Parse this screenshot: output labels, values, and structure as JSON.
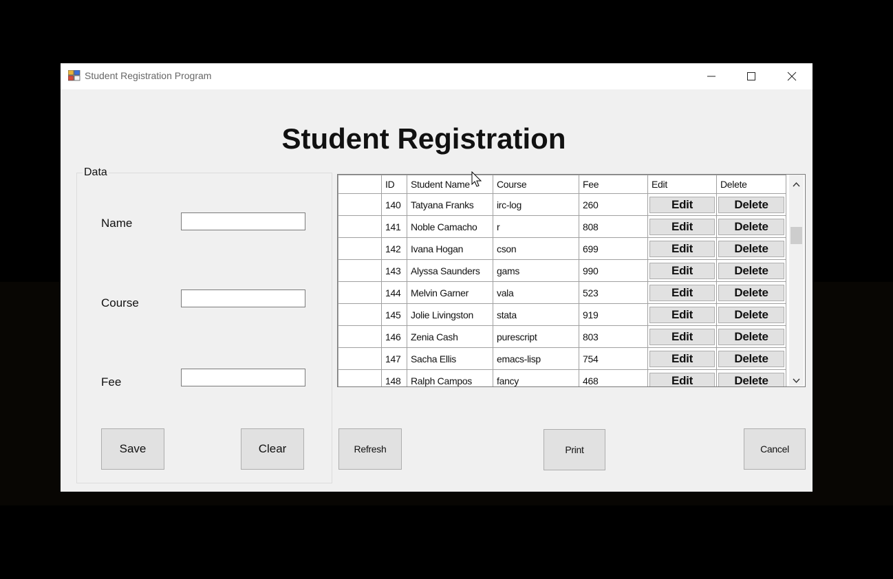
{
  "window": {
    "title": "Student Registration Program",
    "controls": [
      "minimize-icon",
      "maximize-icon",
      "close-icon"
    ]
  },
  "form": {
    "heading": "Student Registration",
    "group_label": "Data",
    "name_label": "Name",
    "name_value": "",
    "course_label": "Course",
    "course_value": "",
    "fee_label": "Fee",
    "fee_value": "",
    "save_label": "Save",
    "clear_label": "Clear"
  },
  "grid": {
    "columns": [
      "",
      "ID",
      "Student Name",
      "Course",
      "Fee",
      "Edit",
      "Delete"
    ],
    "rows": [
      {
        "id": "140",
        "name": "Tatyana Franks",
        "course": "irc-log",
        "fee": "260",
        "edit": "Edit",
        "delete": "Delete"
      },
      {
        "id": "141",
        "name": "Noble Camacho",
        "course": "r",
        "fee": "808",
        "edit": "Edit",
        "delete": "Delete"
      },
      {
        "id": "142",
        "name": "Ivana Hogan",
        "course": "cson",
        "fee": "699",
        "edit": "Edit",
        "delete": "Delete"
      },
      {
        "id": "143",
        "name": "Alyssa Saunders",
        "course": "gams",
        "fee": "990",
        "edit": "Edit",
        "delete": "Delete"
      },
      {
        "id": "144",
        "name": "Melvin Garner",
        "course": "vala",
        "fee": "523",
        "edit": "Edit",
        "delete": "Delete"
      },
      {
        "id": "145",
        "name": "Jolie Livingston",
        "course": "stata",
        "fee": "919",
        "edit": "Edit",
        "delete": "Delete"
      },
      {
        "id": "146",
        "name": "Zenia Cash",
        "course": "purescript",
        "fee": "803",
        "edit": "Edit",
        "delete": "Delete"
      },
      {
        "id": "147",
        "name": "Sacha Ellis",
        "course": "emacs-lisp",
        "fee": "754",
        "edit": "Edit",
        "delete": "Delete"
      },
      {
        "id": "148",
        "name": "Ralph Campos",
        "course": "fancy",
        "fee": "468",
        "edit": "Edit",
        "delete": "Delete"
      }
    ]
  },
  "actions": {
    "refresh_label": "Refresh",
    "print_label": "Print",
    "cancel_label": "Cancel"
  }
}
